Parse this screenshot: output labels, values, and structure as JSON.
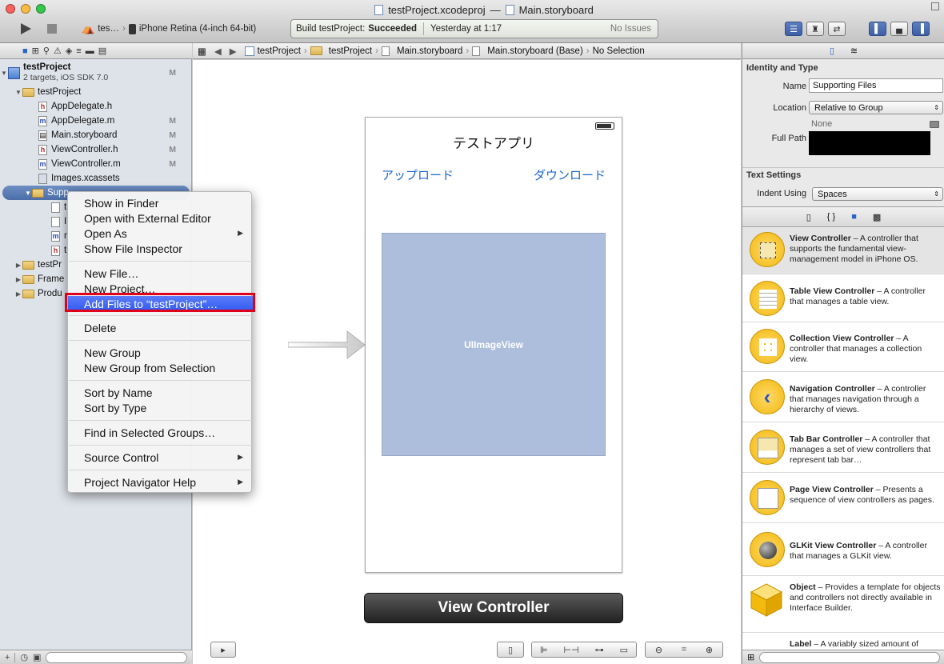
{
  "window": {
    "title_project": "testProject.xcodeproj",
    "title_sep": "—",
    "title_file": "Main.storyboard"
  },
  "toolbar": {
    "scheme_target": "tes…",
    "scheme_device": "iPhone Retina (4-inch 64-bit)",
    "activity_build": "Build testProject:",
    "activity_status": "Succeeded",
    "activity_time": "Yesterday at 1:17",
    "activity_issues": "No Issues"
  },
  "navigator": {
    "project": {
      "name": "testProject",
      "sub": "2 targets, iOS SDK 7.0",
      "badge": "M"
    },
    "rows": [
      {
        "label": "testProject",
        "badge": ""
      },
      {
        "label": "AppDelegate.h",
        "badge": ""
      },
      {
        "label": "AppDelegate.m",
        "badge": "M"
      },
      {
        "label": "Main.storyboard",
        "badge": "M"
      },
      {
        "label": "ViewController.h",
        "badge": "M"
      },
      {
        "label": "ViewController.m",
        "badge": "M"
      },
      {
        "label": "Images.xcassets",
        "badge": ""
      },
      {
        "label": "Supporting Files",
        "badge": ""
      },
      {
        "label": "testProjectTests",
        "badge": ""
      },
      {
        "label": "Frameworks",
        "badge": ""
      },
      {
        "label": "Products",
        "badge": ""
      }
    ],
    "partial_rows": [
      "t",
      "I",
      "m",
      "t"
    ],
    "truncated": {
      "supporting": "Supp",
      "tests": "testPr",
      "frameworks": "Frame",
      "products": "Produ"
    }
  },
  "jumpbar": [
    "testProject",
    "testProject",
    "Main.storyboard",
    "Main.storyboard (Base)",
    "No Selection"
  ],
  "storyboard": {
    "nav_title": "テストアプリ",
    "left_button": "アップロード",
    "right_button": "ダウンロード",
    "image_view_label": "UIImageView",
    "scene_label": "View Controller"
  },
  "inspector": {
    "identity_header": "Identity and Type",
    "name_label": "Name",
    "name_value": "Supporting Files",
    "location_label": "Location",
    "location_value": "Relative to Group",
    "none_text": "None",
    "full_path_label": "Full Path",
    "text_settings_header": "Text Settings",
    "indent_label": "Indent Using",
    "indent_value": "Spaces",
    "library_tabs": [
      "file-template",
      "code-snippet",
      "object",
      "media"
    ],
    "library": [
      {
        "name": "View Controller",
        "desc": " – A controller that supports the fundamental view-management model in iPhone OS."
      },
      {
        "name": "Table View Controller",
        "desc": " – A controller that manages a table view."
      },
      {
        "name": "Collection View Controller",
        "desc": " – A controller that manages a collection view."
      },
      {
        "name": "Navigation Controller",
        "desc": " – A controller that manages navigation through a hierarchy of views."
      },
      {
        "name": "Tab Bar Controller",
        "desc": " – A controller that manages a set of view controllers that represent tab bar…"
      },
      {
        "name": "Page View Controller",
        "desc": " – Presents a sequence of view controllers as pages."
      },
      {
        "name": "GLKit View Controller",
        "desc": " – A controller that manages a GLKit view."
      },
      {
        "name": "Object",
        "desc": " – Provides a template for objects and controllers not directly available in Interface Builder."
      },
      {
        "name": "Label",
        "desc": " – A variably sized amount of"
      }
    ]
  },
  "context_menu": {
    "items": [
      {
        "label": "Show in Finder",
        "sub": false
      },
      {
        "label": "Open with External Editor",
        "sub": false
      },
      {
        "label": "Open As",
        "sub": true
      },
      {
        "label": "Show File Inspector",
        "sub": false
      },
      {
        "label": "New File…",
        "sub": false
      },
      {
        "label": "New Project…",
        "sub": false
      },
      {
        "label": "Add Files to “testProject”…",
        "sub": false
      },
      {
        "label": "Delete",
        "sub": false
      },
      {
        "label": "New Group",
        "sub": false
      },
      {
        "label": "New Group from Selection",
        "sub": false
      },
      {
        "label": "Sort by Name",
        "sub": false
      },
      {
        "label": "Sort by Type",
        "sub": false
      },
      {
        "label": "Find in Selected Groups…",
        "sub": false
      },
      {
        "label": "Source Control",
        "sub": true
      },
      {
        "label": "Project Navigator Help",
        "sub": true
      }
    ],
    "highlighted_index": 6,
    "highlight_color": "#2e5bf2",
    "annotation_color": "#e0001b"
  }
}
